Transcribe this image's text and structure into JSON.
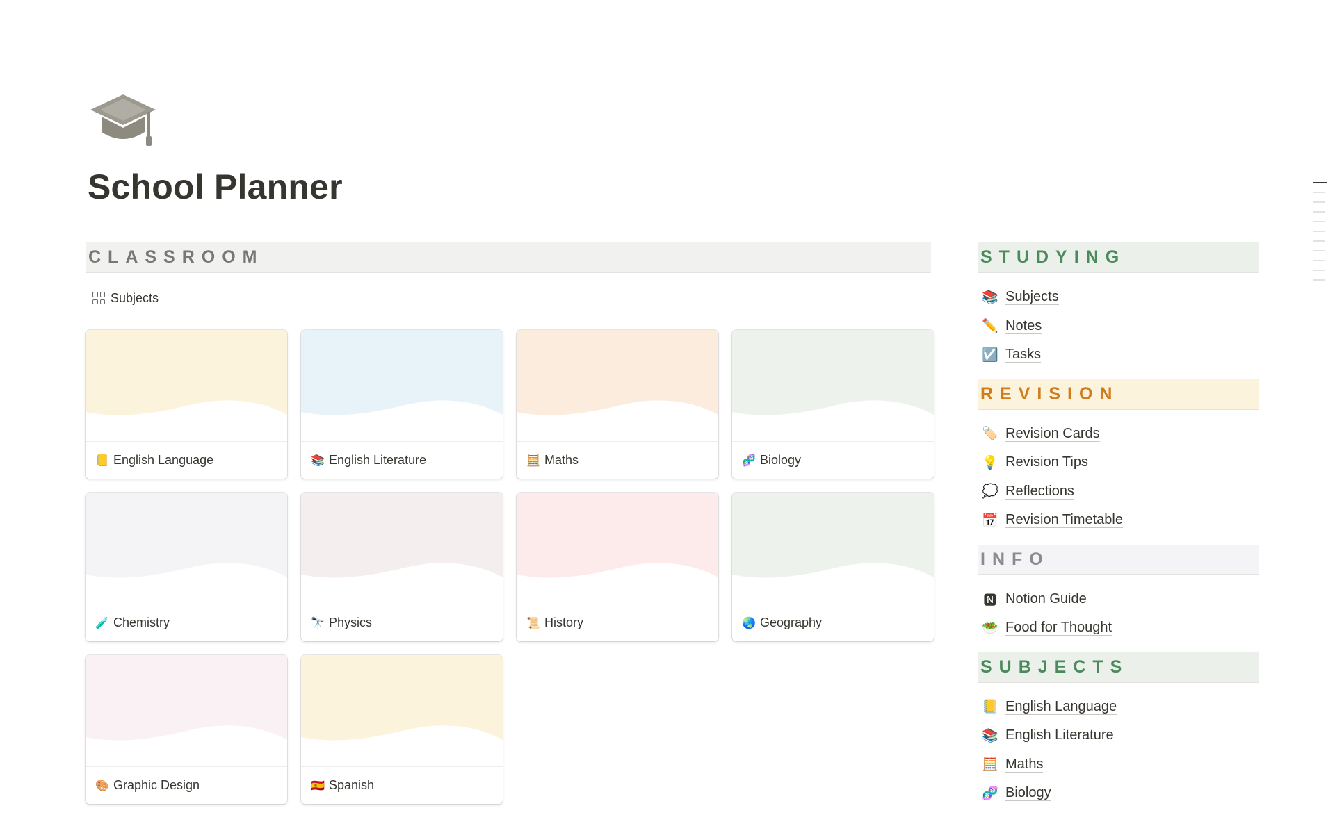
{
  "page": {
    "title": "School Planner",
    "icon": "graduation-cap-icon"
  },
  "classroom": {
    "header": "CLASSROOM",
    "view_tab": {
      "label": "Subjects",
      "icon": "gallery-grid-icon"
    },
    "cards": [
      {
        "label": "English Language",
        "emoji": "📒",
        "cover": "#fbf3db"
      },
      {
        "label": "English Literature",
        "emoji": "📚",
        "cover": "#e7f3f8"
      },
      {
        "label": "Maths",
        "emoji": "🧮",
        "cover": "#fbecdd"
      },
      {
        "label": "Biology",
        "emoji": "🧬",
        "cover": "#edf3ec"
      },
      {
        "label": "Chemistry",
        "emoji": "🧪",
        "cover": "#f4f4f7"
      },
      {
        "label": "Physics",
        "emoji": "🔭",
        "cover": "#f4eeee"
      },
      {
        "label": "History",
        "emoji": "📜",
        "cover": "#fdebec"
      },
      {
        "label": "Geography",
        "emoji": "🌏",
        "cover": "#edf3ec"
      },
      {
        "label": "Graphic Design",
        "emoji": "🎨",
        "cover": "#faf1f5"
      },
      {
        "label": "Spanish",
        "emoji": "🇪🇸",
        "cover": "#fbf3db"
      }
    ]
  },
  "sidebar": {
    "studying": {
      "header": "STUDYING",
      "items": [
        {
          "label": "Subjects",
          "emoji": "📚"
        },
        {
          "label": "Notes",
          "emoji": "✏️"
        },
        {
          "label": "Tasks",
          "emoji": "☑️"
        }
      ]
    },
    "revision": {
      "header": "REVISION",
      "items": [
        {
          "label": "Revision Cards",
          "emoji": "🏷️"
        },
        {
          "label": "Revision Tips",
          "emoji": "💡"
        },
        {
          "label": "Reflections",
          "emoji": "💭"
        },
        {
          "label": "Revision Timetable",
          "emoji": "📅"
        }
      ]
    },
    "info": {
      "header": "INFO",
      "items": [
        {
          "label": "Notion Guide",
          "emoji": "🅽"
        },
        {
          "label": "Food for Thought",
          "emoji": "🥗"
        }
      ]
    },
    "subjects": {
      "header": "SUBJECTS",
      "items": [
        {
          "label": "English Language",
          "emoji": "📒"
        },
        {
          "label": "English Literature",
          "emoji": "📚"
        },
        {
          "label": "Maths",
          "emoji": "🧮"
        },
        {
          "label": "Biology",
          "emoji": "🧬"
        }
      ]
    }
  },
  "colors": {
    "text": "#37352f",
    "studying_accent": "#4b8a5c",
    "revision_accent": "#d07c1c",
    "info_accent": "#8a8a8f"
  }
}
